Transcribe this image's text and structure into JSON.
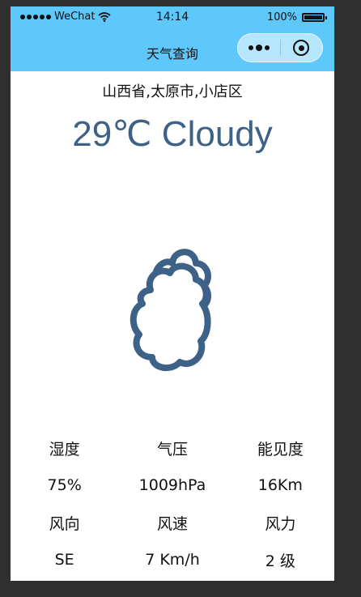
{
  "status_bar": {
    "carrier": "WeChat",
    "time": "14:14",
    "battery": "100%"
  },
  "nav": {
    "title": "天气查询"
  },
  "weather": {
    "location": "山西省,太原市,小店区",
    "headline": "29℃ Cloudy",
    "icon": "cloudy-icon"
  },
  "details": {
    "rows": [
      [
        "湿度",
        "气压",
        "能见度"
      ],
      [
        "75%",
        "1009hPa",
        "16Km"
      ],
      [
        "风向",
        "风速",
        "风力"
      ],
      [
        "SE",
        "7 Km/h",
        "2 级"
      ]
    ]
  },
  "colors": {
    "topbar": "#5ec8fb",
    "headline": "#3e6188",
    "icon_stroke": "#3e6188",
    "background": "#2f2f2f"
  }
}
